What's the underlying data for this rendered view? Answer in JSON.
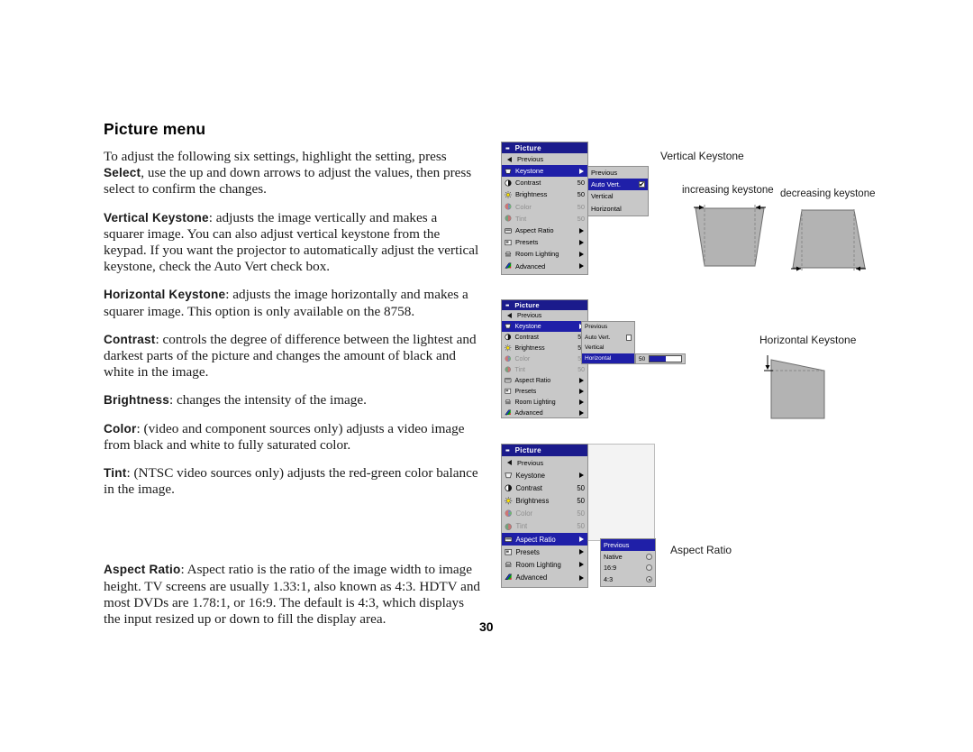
{
  "page": {
    "title": "Picture menu",
    "number": "30"
  },
  "paragraphs": [
    {
      "lead": "",
      "text": "To adjust the following six settings, highlight the setting, press Select, use the up and down arrows to adjust the values, then press select to confirm the changes.",
      "bold_inline": "Select"
    },
    {
      "lead": "Vertical Keystone",
      "text": ": adjusts the image vertically and makes a squarer image. You can also adjust vertical keystone from the keypad. If you want the projector to automatically adjust the vertical keystone, check the Auto Vert check box."
    },
    {
      "lead": "Horizontal Keystone",
      "text": ": adjusts the image horizontally and makes a squarer image. This option is only available on the 8758."
    },
    {
      "lead": "Contrast",
      "text": ": controls the degree of difference between the lightest and darkest parts of the picture and changes the amount of black and white in the image."
    },
    {
      "lead": "Brightness",
      "text": ": changes the intensity of the image."
    },
    {
      "lead": "Color",
      "text": ": (video and component sources only) adjusts a video image from black and white to fully saturated color."
    },
    {
      "lead": "Tint",
      "text": ": (NTSC video sources only) adjusts the red-green color balance in the image."
    },
    {
      "lead": "Aspect Ratio",
      "text": ": Aspect ratio is the ratio of the image width to image height. TV screens are usually 1.33:1, also known as 4:3. HDTV and most DVDs are 1.78:1, or 16:9. The default is 4:3, which displays the input resized up or down to fill the display area."
    }
  ],
  "colors": {
    "menu_title_bg": "#1b1b8c",
    "menu_highlight_bg": "#1f1fa8",
    "menu_panel_bg": "#c8c8c8",
    "menu_border": "#8f8f8f",
    "menu_text": "#000000",
    "menu_text_disabled": "#8e8e8e",
    "menu_text_selected": "#ffffff",
    "diagram_fill": "#b3b3b3",
    "diagram_stroke": "#555555"
  },
  "menu_common": {
    "title": "Picture",
    "title_icon": "dots-icon",
    "previous_label": "Previous",
    "previous_icon": "left-triangle-icon",
    "items": [
      {
        "label": "Keystone",
        "icon": "keystone-icon",
        "value": "",
        "arrow": true,
        "disabled": false
      },
      {
        "label": "Contrast",
        "icon": "contrast-icon",
        "value": "50",
        "arrow": false,
        "disabled": false
      },
      {
        "label": "Brightness",
        "icon": "brightness-icon",
        "value": "50",
        "arrow": false,
        "disabled": false
      },
      {
        "label": "Color",
        "icon": "color-icon",
        "value": "50",
        "arrow": false,
        "disabled": true
      },
      {
        "label": "Tint",
        "icon": "tint-icon",
        "value": "50",
        "arrow": false,
        "disabled": true
      },
      {
        "label": "Aspect Ratio",
        "icon": "aspect-ratio-icon",
        "value": "",
        "arrow": true,
        "disabled": false
      },
      {
        "label": "Presets",
        "icon": "presets-icon",
        "value": "",
        "arrow": true,
        "disabled": false
      },
      {
        "label": "Room Lighting",
        "icon": "room-lighting-icon",
        "value": "",
        "arrow": true,
        "disabled": false
      },
      {
        "label": "Advanced",
        "icon": "advanced-icon",
        "value": "",
        "arrow": true,
        "disabled": false
      }
    ]
  },
  "menu1": {
    "selected_item": "Keystone",
    "submenu": {
      "rows": [
        {
          "label": "Previous",
          "control": "none",
          "checked": false,
          "selected": false
        },
        {
          "label": "Auto Vert.",
          "control": "checkbox",
          "checked": true,
          "selected": true
        },
        {
          "label": "Vertical",
          "control": "none",
          "checked": false,
          "selected": false
        },
        {
          "label": "Horizontal",
          "control": "none",
          "checked": false,
          "selected": false
        }
      ]
    }
  },
  "menu2": {
    "selected_item": "Keystone",
    "submenu": {
      "rows": [
        {
          "label": "Previous",
          "control": "none",
          "checked": false,
          "selected": false
        },
        {
          "label": "Auto Vert.",
          "control": "checkbox",
          "checked": false,
          "selected": false
        },
        {
          "label": "Vertical",
          "control": "none",
          "checked": false,
          "selected": false
        },
        {
          "label": "Horizontal",
          "control": "none",
          "checked": false,
          "selected": true
        }
      ]
    },
    "slider": {
      "value": "50",
      "fill_percent": 52
    }
  },
  "menu3": {
    "selected_item": "Aspect Ratio",
    "submenu": {
      "rows": [
        {
          "label": "Previous",
          "control": "none",
          "checked": false,
          "selected": true
        },
        {
          "label": "Native",
          "control": "radio",
          "checked": false,
          "selected": false
        },
        {
          "label": "16:9",
          "control": "radio",
          "checked": false,
          "selected": false
        },
        {
          "label": "4:3",
          "control": "radio",
          "checked": true,
          "selected": false
        }
      ]
    }
  },
  "diagrams": {
    "vertical_keystone_title": "Vertical Keystone",
    "increasing_label": "increasing keystone",
    "decreasing_label": "decreasing keystone",
    "horizontal_keystone_title": "Horizontal Keystone",
    "aspect_ratio_caption": "Aspect Ratio"
  }
}
